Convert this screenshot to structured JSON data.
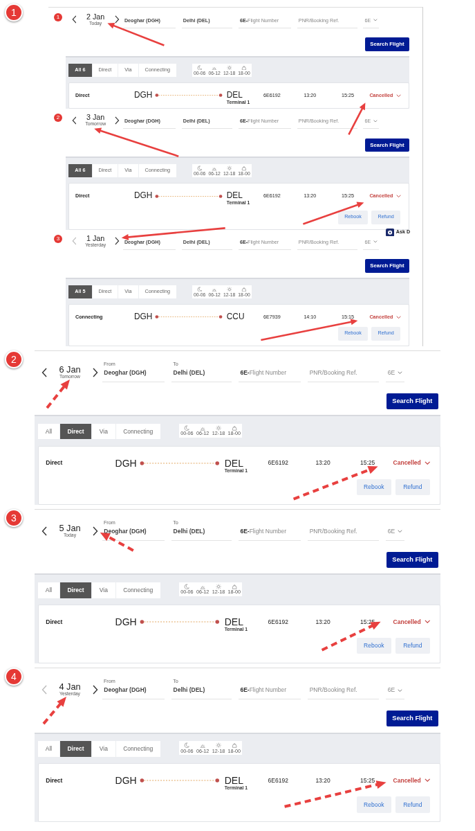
{
  "panels": [
    {
      "badge": "1",
      "dashed_arrows": false,
      "screens": [
        {
          "badge": "1",
          "date": {
            "day": "2 Jan",
            "relative": "Today",
            "prev_disabled": false
          },
          "from": {
            "value": "Deoghar (DGH)"
          },
          "to": {
            "value": "Delhi (DEL)"
          },
          "flight_number": {
            "prefix": "6E-",
            "placeholder": "Flight Number"
          },
          "pnr": {
            "placeholder": "PNR/Booking Ref."
          },
          "airline": {
            "value": "6E"
          },
          "search_button": "Search Flight",
          "filter_tabs": [
            {
              "label": "All 6",
              "selected": true
            },
            {
              "label": "Direct",
              "selected": false
            },
            {
              "label": "Via",
              "selected": false
            },
            {
              "label": "Connecting",
              "selected": false
            }
          ],
          "time_slots": [
            "00-06",
            "06-12",
            "12-18",
            "18-00"
          ],
          "flight": {
            "type": "Direct",
            "origin": "DGH",
            "destination": "DEL",
            "terminal": "Terminal 1",
            "flight_number": "6E6192",
            "departure": "13:20",
            "arrival": "15:25",
            "status": "Cancelled"
          }
        },
        {
          "badge": "2",
          "date": {
            "day": "3 Jan",
            "relative": "Tomorrow",
            "prev_disabled": false
          },
          "from": {
            "value": "Deoghar (DGH)"
          },
          "to": {
            "value": "Delhi (DEL)"
          },
          "flight_number": {
            "prefix": "6E-",
            "placeholder": "Flight Number"
          },
          "pnr": {
            "placeholder": "PNR/Booking Ref."
          },
          "airline": {
            "value": "6E"
          },
          "search_button": "Search Flight",
          "filter_tabs": [
            {
              "label": "All 6",
              "selected": true
            },
            {
              "label": "Direct",
              "selected": false
            },
            {
              "label": "Via",
              "selected": false
            },
            {
              "label": "Connecting",
              "selected": false
            }
          ],
          "time_slots": [
            "00-06",
            "06-12",
            "12-18",
            "18-00"
          ],
          "flight": {
            "type": "Direct",
            "origin": "DGH",
            "destination": "DEL",
            "terminal": "Terminal 1",
            "flight_number": "6E6192",
            "departure": "13:20",
            "arrival": "15:25",
            "status": "Cancelled",
            "actions": [
              "Rebook",
              "Refund"
            ]
          },
          "chat": {
            "label": "Ask D"
          }
        },
        {
          "badge": "3",
          "date": {
            "day": "1 Jan",
            "relative": "Yesterday",
            "prev_disabled": true
          },
          "from": {
            "value": "Deoghar (DGH)"
          },
          "to": {
            "value": "Delhi (DEL)"
          },
          "flight_number": {
            "prefix": "6E-",
            "placeholder": "Flight Number"
          },
          "pnr": {
            "placeholder": "PNR/Booking Ref."
          },
          "airline": {
            "value": "6E"
          },
          "search_button": "Search Flight",
          "filter_tabs": [
            {
              "label": "All 5",
              "selected": true
            },
            {
              "label": "Direct",
              "selected": false
            },
            {
              "label": "Via",
              "selected": false
            },
            {
              "label": "Connecting",
              "selected": false
            }
          ],
          "time_slots": [
            "00-06",
            "06-12",
            "12-18",
            "18-00"
          ],
          "flight": {
            "type": "Connecting",
            "origin": "DGH",
            "destination": "CCU",
            "flight_number": "6E7939",
            "departure": "14:10",
            "arrival": "15:15",
            "status": "Cancelled",
            "actions": [
              "Rebook",
              "Refund"
            ]
          }
        }
      ]
    },
    {
      "badge": "2",
      "dashed_arrows": true,
      "screens": [
        {
          "date": {
            "day": "6 Jan",
            "relative": "Tomorrow",
            "prev_disabled": false
          },
          "from": {
            "label": "From",
            "value": "Deoghar (DGH)"
          },
          "to": {
            "label": "To",
            "value": "Delhi (DEL)"
          },
          "flight_number": {
            "prefix": "6E-",
            "placeholder": "Flight Number"
          },
          "pnr": {
            "placeholder": "PNR/Booking Ref."
          },
          "airline": {
            "value": "6E"
          },
          "search_button": "Search Flight",
          "filter_tabs": [
            {
              "label": "All",
              "selected": false
            },
            {
              "label": "Direct",
              "selected": true
            },
            {
              "label": "Via",
              "selected": false
            },
            {
              "label": "Connecting",
              "selected": false
            }
          ],
          "time_slots": [
            "00-06",
            "06-12",
            "12-18",
            "18-00"
          ],
          "flight": {
            "type": "Direct",
            "origin": "DGH",
            "destination": "DEL",
            "terminal": "Terminal 1",
            "flight_number": "6E6192",
            "departure": "13:20",
            "arrival": "15:25",
            "status": "Cancelled",
            "actions": [
              "Rebook",
              "Refund"
            ]
          }
        }
      ]
    },
    {
      "badge": "3",
      "dashed_arrows": true,
      "screens": [
        {
          "date": {
            "day": "5 Jan",
            "relative": "Today",
            "prev_disabled": false
          },
          "from": {
            "label": "From",
            "value": "Deoghar (DGH)"
          },
          "to": {
            "label": "To",
            "value": "Delhi (DEL)"
          },
          "flight_number": {
            "prefix": "6E-",
            "placeholder": "Flight Number"
          },
          "pnr": {
            "placeholder": "PNR/Booking Ref."
          },
          "airline": {
            "value": "6E"
          },
          "search_button": "Search Flight",
          "filter_tabs": [
            {
              "label": "All",
              "selected": false
            },
            {
              "label": "Direct",
              "selected": true
            },
            {
              "label": "Via",
              "selected": false
            },
            {
              "label": "Connecting",
              "selected": false
            }
          ],
          "time_slots": [
            "00-06",
            "06-12",
            "12-18",
            "18-00"
          ],
          "flight": {
            "type": "Direct",
            "origin": "DGH",
            "destination": "DEL",
            "terminal": "Terminal 1",
            "flight_number": "6E6192",
            "departure": "13:20",
            "arrival": "15:25",
            "status": "Cancelled",
            "actions": [
              "Rebook",
              "Refund"
            ]
          }
        }
      ]
    },
    {
      "badge": "4",
      "dashed_arrows": true,
      "screens": [
        {
          "date": {
            "day": "4 Jan",
            "relative": "Yesterday",
            "prev_disabled": true
          },
          "from": {
            "label": "From",
            "value": "Deoghar (DGH)"
          },
          "to": {
            "label": "To",
            "value": "Delhi (DEL)"
          },
          "flight_number": {
            "prefix": "6E-",
            "placeholder": "Flight Number"
          },
          "pnr": {
            "placeholder": "PNR/Booking Ref."
          },
          "airline": {
            "value": "6E"
          },
          "search_button": "Search Flight",
          "filter_tabs": [
            {
              "label": "All",
              "selected": false
            },
            {
              "label": "Direct",
              "selected": true
            },
            {
              "label": "Via",
              "selected": false
            },
            {
              "label": "Connecting",
              "selected": false
            }
          ],
          "time_slots": [
            "00-06",
            "06-12",
            "12-18",
            "18-00"
          ],
          "flight": {
            "type": "Direct",
            "origin": "DGH",
            "destination": "DEL",
            "terminal": "Terminal 1",
            "flight_number": "6E6192",
            "departure": "13:20",
            "arrival": "15:25",
            "status": "Cancelled",
            "actions": [
              "Rebook",
              "Refund"
            ]
          }
        }
      ]
    }
  ]
}
